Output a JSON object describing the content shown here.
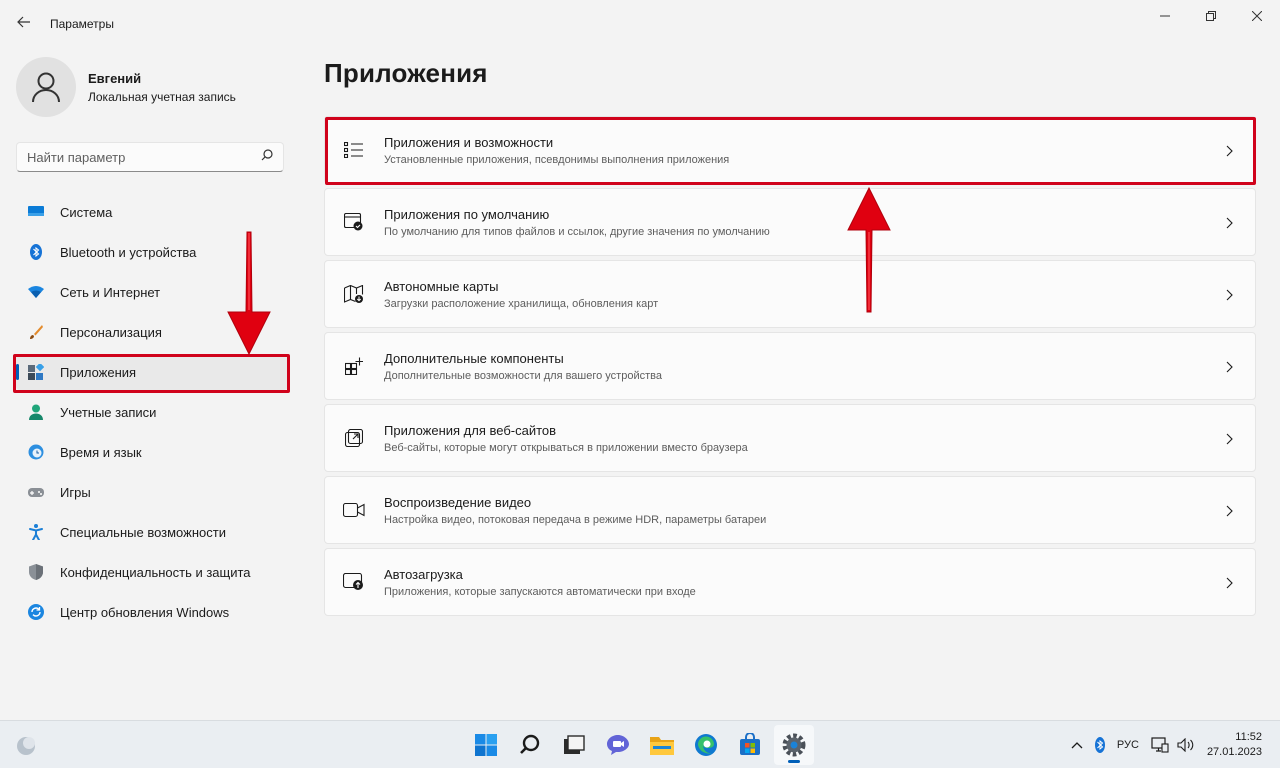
{
  "window": {
    "title": "Параметры",
    "back_icon": "back-arrow-icon"
  },
  "profile": {
    "name": "Евгений",
    "account_type": "Локальная учетная запись"
  },
  "search": {
    "placeholder": "Найти параметр"
  },
  "sidebar": {
    "items": [
      {
        "label": "Система",
        "icon": "system-icon",
        "active": false
      },
      {
        "label": "Bluetooth и устройства",
        "icon": "bluetooth-icon",
        "active": false
      },
      {
        "label": "Сеть и Интернет",
        "icon": "network-icon",
        "active": false
      },
      {
        "label": "Персонализация",
        "icon": "brush-icon",
        "active": false
      },
      {
        "label": "Приложения",
        "icon": "apps-icon",
        "active": true
      },
      {
        "label": "Учетные записи",
        "icon": "account-icon",
        "active": false
      },
      {
        "label": "Время и язык",
        "icon": "clock-globe-icon",
        "active": false
      },
      {
        "label": "Игры",
        "icon": "gamepad-icon",
        "active": false
      },
      {
        "label": "Специальные возможности",
        "icon": "accessibility-icon",
        "active": false
      },
      {
        "label": "Конфиденциальность и защита",
        "icon": "shield-icon",
        "active": false
      },
      {
        "label": "Центр обновления Windows",
        "icon": "update-icon",
        "active": false
      }
    ]
  },
  "main": {
    "title": "Приложения",
    "cards": [
      {
        "title": "Приложения и возможности",
        "subtitle": "Установленные приложения, псевдонимы выполнения приложения",
        "icon": "apps-list-icon"
      },
      {
        "title": "Приложения по умолчанию",
        "subtitle": "По умолчанию для типов файлов и ссылок, другие значения по умолчанию",
        "icon": "default-apps-icon"
      },
      {
        "title": "Автономные карты",
        "subtitle": "Загрузки расположение хранилища, обновления карт",
        "icon": "offline-map-icon"
      },
      {
        "title": "Дополнительные компоненты",
        "subtitle": "Дополнительные возможности для вашего устройства",
        "icon": "optional-features-icon"
      },
      {
        "title": "Приложения для веб-сайтов",
        "subtitle": "Веб-сайты, которые могут открываться в приложении вместо браузера",
        "icon": "website-apps-icon"
      },
      {
        "title": "Воспроизведение видео",
        "subtitle": "Настройка видео, потоковая передача в режиме HDR, параметры батареи",
        "icon": "video-icon"
      },
      {
        "title": "Автозагрузка",
        "subtitle": "Приложения, которые запускаются автоматически при входе",
        "icon": "startup-icon"
      }
    ]
  },
  "taskbar": {
    "apps": [
      "start-icon",
      "search-icon",
      "task-view-icon",
      "chat-icon",
      "file-explorer-icon",
      "edge-icon",
      "store-icon",
      "settings-icon"
    ],
    "tray": {
      "language": "РУС",
      "time": "11:52",
      "date": "27.01.2023"
    }
  },
  "colors": {
    "accent": "#005fb8",
    "annotation": "#d0021b"
  }
}
